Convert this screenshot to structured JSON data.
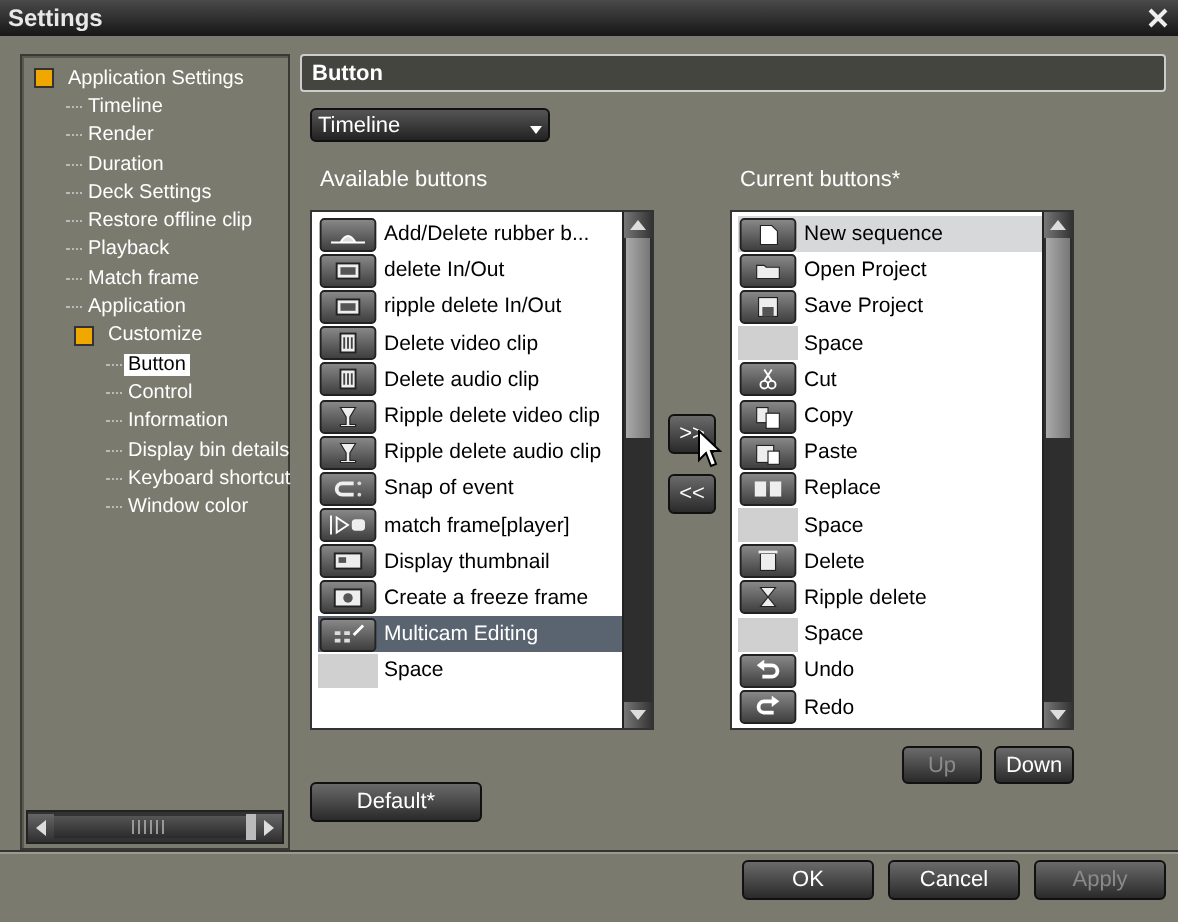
{
  "window": {
    "title": "Settings"
  },
  "tree": [
    {
      "label": "Application Settings",
      "expanded": true,
      "selected": false,
      "children": [
        {
          "label": "Timeline",
          "selected": false
        },
        {
          "label": "Render",
          "selected": false
        },
        {
          "label": "Duration",
          "selected": false
        },
        {
          "label": "Deck Settings",
          "selected": false
        },
        {
          "label": "Restore offline clip",
          "selected": false
        },
        {
          "label": "Playback",
          "selected": false
        },
        {
          "label": "Match frame",
          "selected": false
        },
        {
          "label": "Application",
          "selected": false
        },
        {
          "label": "Customize",
          "expanded": true,
          "selected": false,
          "children": [
            {
              "label": "Button",
              "selected": true
            },
            {
              "label": "Control",
              "selected": false
            },
            {
              "label": "Information",
              "selected": false
            },
            {
              "label": "Display bin details",
              "selected": false
            },
            {
              "label": "Keyboard shortcut",
              "selected": false
            },
            {
              "label": "Window color",
              "selected": false
            }
          ]
        }
      ]
    }
  ],
  "panel": {
    "title": "Button",
    "category": "Timeline"
  },
  "available": {
    "label": "Available buttons",
    "items": [
      {
        "kind": "button",
        "label": "Add/Delete rubber b...",
        "selected": false
      },
      {
        "kind": "button",
        "label": "delete In/Out",
        "selected": false
      },
      {
        "kind": "button",
        "label": "ripple delete In/Out",
        "selected": false
      },
      {
        "kind": "button",
        "label": "Delete video clip",
        "selected": false
      },
      {
        "kind": "button",
        "label": "Delete audio clip",
        "selected": false
      },
      {
        "kind": "button",
        "label": "Ripple delete video clip",
        "selected": false
      },
      {
        "kind": "button",
        "label": "Ripple delete audio clip",
        "selected": false
      },
      {
        "kind": "button",
        "label": "Snap of event",
        "selected": false
      },
      {
        "kind": "button",
        "label": "match frame[player]",
        "selected": false
      },
      {
        "kind": "button",
        "label": "Display thumbnail",
        "selected": false
      },
      {
        "kind": "button",
        "label": "Create a freeze frame",
        "selected": false
      },
      {
        "kind": "button",
        "label": "Multicam Editing",
        "selected": true
      },
      {
        "kind": "space",
        "label": "Space",
        "selected": false
      }
    ]
  },
  "move_buttons": [
    {
      "label": ">>"
    },
    {
      "label": "<<"
    }
  ],
  "current": {
    "label": "Current buttons*",
    "items": [
      {
        "kind": "button",
        "label": "New sequence",
        "selected": true
      },
      {
        "kind": "button",
        "label": "Open Project",
        "selected": false
      },
      {
        "kind": "button",
        "label": "Save Project",
        "selected": false
      },
      {
        "kind": "space",
        "label": "Space",
        "selected": false
      },
      {
        "kind": "button",
        "label": "Cut",
        "selected": false
      },
      {
        "kind": "button",
        "label": "Copy",
        "selected": false
      },
      {
        "kind": "button",
        "label": "Paste",
        "selected": false
      },
      {
        "kind": "button",
        "label": "Replace",
        "selected": false
      },
      {
        "kind": "space",
        "label": "Space",
        "selected": false
      },
      {
        "kind": "button",
        "label": "Delete",
        "selected": false
      },
      {
        "kind": "button",
        "label": "Ripple delete",
        "selected": false
      },
      {
        "kind": "space",
        "label": "Space",
        "selected": false
      },
      {
        "kind": "button",
        "label": "Undo",
        "selected": false
      },
      {
        "kind": "button",
        "label": "Redo",
        "selected": false
      }
    ]
  },
  "order_buttons": [
    {
      "label": "Up",
      "disabled": true
    },
    {
      "label": "Down",
      "disabled": false
    }
  ],
  "default_button": {
    "label": "Default*"
  },
  "dialog_buttons": [
    {
      "label": "OK",
      "disabled": false
    },
    {
      "label": "Cancel",
      "disabled": false
    },
    {
      "label": "Apply",
      "disabled": true
    }
  ]
}
